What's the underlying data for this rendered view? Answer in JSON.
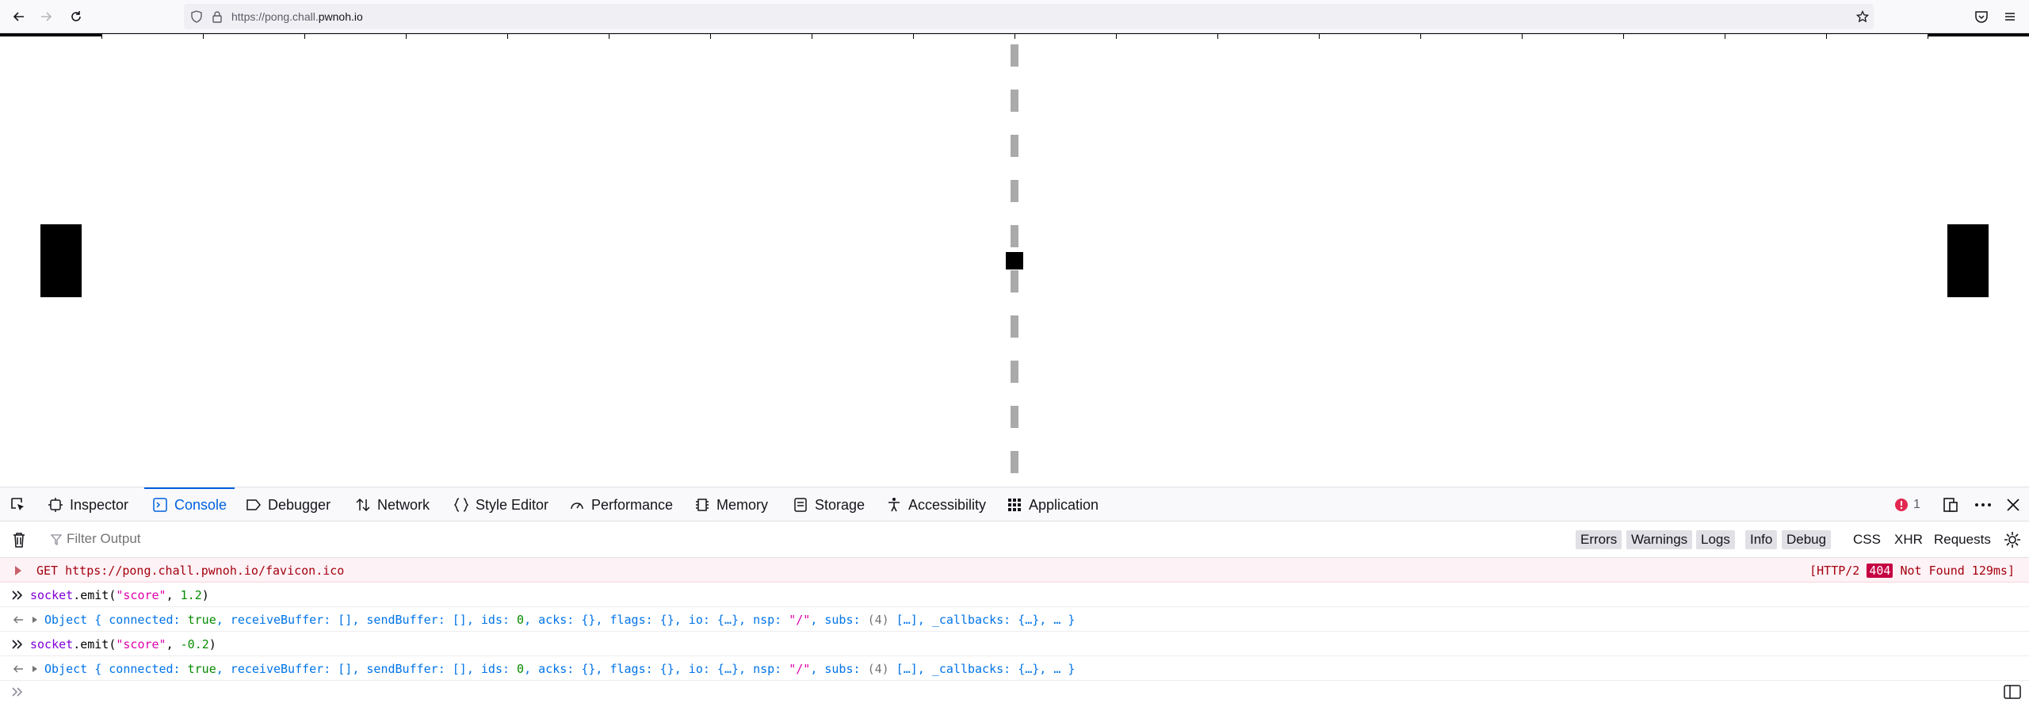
{
  "browser": {
    "url_prefix": "https://pong.chall.",
    "url_domain": "pwnoh.io"
  },
  "devtools": {
    "tabs": [
      {
        "label": "Inspector",
        "icon": "inspector-icon"
      },
      {
        "label": "Console",
        "icon": "console-icon"
      },
      {
        "label": "Debugger",
        "icon": "debugger-icon"
      },
      {
        "label": "Network",
        "icon": "network-icon"
      },
      {
        "label": "Style Editor",
        "icon": "style-editor-icon"
      },
      {
        "label": "Performance",
        "icon": "performance-icon"
      },
      {
        "label": "Memory",
        "icon": "memory-icon"
      },
      {
        "label": "Storage",
        "icon": "storage-icon"
      },
      {
        "label": "Accessibility",
        "icon": "accessibility-icon"
      },
      {
        "label": "Application",
        "icon": "application-icon"
      }
    ],
    "active_tab": "Console",
    "error_count": "1",
    "filter_placeholder": "Filter Output",
    "filters": [
      "Errors",
      "Warnings",
      "Logs",
      "Info",
      "Debug"
    ],
    "filters_plain": [
      "CSS",
      "XHR",
      "Requests"
    ]
  },
  "console": {
    "error_row": {
      "method": "GET",
      "url": "https://pong.chall.pwnoh.io/favicon.ico",
      "status_prefix": "[HTTP/2",
      "status_code": "404",
      "status_suffix": "Not Found 129ms]"
    },
    "cmd1": {
      "obj": "socket",
      "method": ".emit(",
      "arg1": "\"score\"",
      "sep": ", ",
      "arg2": "1.2",
      "close": ")"
    },
    "cmd2": {
      "obj": "socket",
      "method": ".emit(",
      "arg1": "\"score\"",
      "sep": ", ",
      "arg2": "-0.2",
      "close": ")"
    },
    "result": {
      "p1": "Object { connected: ",
      "v1": "true",
      "p2": ", receiveBuffer: [], sendBuffer: [], ids: ",
      "v2": "0",
      "p3": ", acks: {}, flags: {}, io: {…}, nsp: ",
      "v3": "\"/\"",
      "p4": ", subs: ",
      "v4": "(4)",
      "p5": " […], _callbacks: {…}, … }"
    }
  },
  "colors": {
    "accent": "#0061e0",
    "error_bg": "#fdf2f5",
    "error_text": "#a4000f",
    "center_line": "#aaaaaa"
  }
}
